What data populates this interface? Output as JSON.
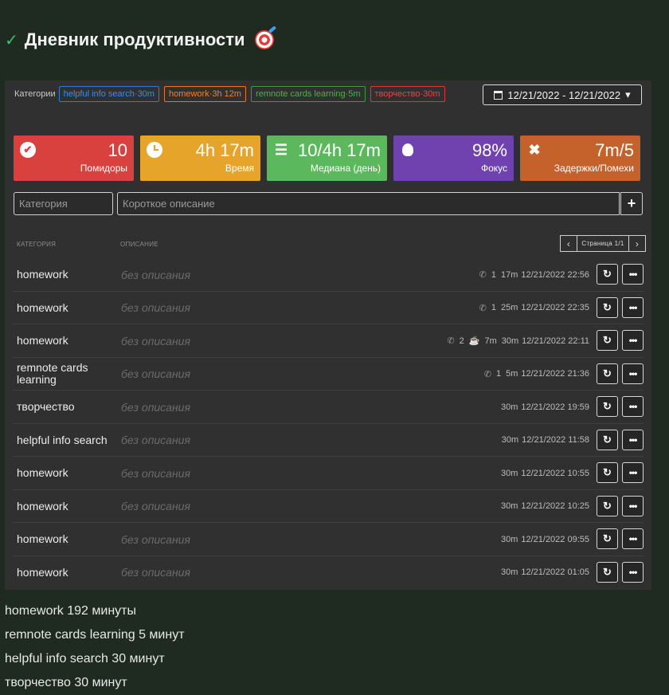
{
  "header": {
    "title": "Дневник продуктивности",
    "check": "✓"
  },
  "categories": {
    "label": "Категории",
    "tags": [
      {
        "text": "helpful info search·30m",
        "color": "blue"
      },
      {
        "text": "homework·3h 12m",
        "color": "orange"
      },
      {
        "text": "remnote cards learning·5m",
        "color": "green"
      },
      {
        "text": "творчество·30m",
        "color": "red"
      }
    ]
  },
  "date_range": "12/21/2022 - 12/21/2022",
  "stats": [
    {
      "value": "10",
      "caption": "Помидоры",
      "icon": "check-circle-icon",
      "color": "#d9413e"
    },
    {
      "value": "4h 17m",
      "caption": "Время",
      "icon": "clock-icon",
      "color": "#e6a52a"
    },
    {
      "value": "10/4h 17m",
      "caption": "Медиана (день)",
      "icon": "list-icon",
      "color": "#5cb85c"
    },
    {
      "value": "98%",
      "caption": "Фокус",
      "icon": "lightbulb-icon",
      "color": "#6f42b0"
    },
    {
      "value": "7m/5",
      "caption": "Задержки/Помехи",
      "icon": "close-icon",
      "color": "#c5612a"
    }
  ],
  "form": {
    "category_placeholder": "Категория",
    "description_placeholder": "Короткое описание",
    "add": "+"
  },
  "table": {
    "col_category": "КАТЕГОРИЯ",
    "col_description": "ОПИСАНИЕ",
    "page_label": "Страница 1/1",
    "empty_description": "без описания",
    "rows": [
      {
        "category": "homework",
        "calls": "1",
        "break": "",
        "duration": "17m",
        "datetime": "12/21/2022 22:56"
      },
      {
        "category": "homework",
        "calls": "1",
        "break": "",
        "duration": "25m",
        "datetime": "12/21/2022 22:35"
      },
      {
        "category": "homework",
        "calls": "2",
        "break": "7m",
        "duration": "30m",
        "datetime": "12/21/2022 22:11"
      },
      {
        "category": "remnote cards learning",
        "calls": "1",
        "break": "",
        "duration": "5m",
        "datetime": "12/21/2022 21:36"
      },
      {
        "category": "творчество",
        "calls": "",
        "break": "",
        "duration": "30m",
        "datetime": "12/21/2022 19:59"
      },
      {
        "category": "helpful info search",
        "calls": "",
        "break": "",
        "duration": "30m",
        "datetime": "12/21/2022 11:58"
      },
      {
        "category": "homework",
        "calls": "",
        "break": "",
        "duration": "30m",
        "datetime": "12/21/2022 10:55"
      },
      {
        "category": "homework",
        "calls": "",
        "break": "",
        "duration": "30m",
        "datetime": "12/21/2022 10:25"
      },
      {
        "category": "homework",
        "calls": "",
        "break": "",
        "duration": "30m",
        "datetime": "12/21/2022 09:55"
      },
      {
        "category": "homework",
        "calls": "",
        "break": "",
        "duration": "30m",
        "datetime": "12/21/2022 01:05"
      }
    ]
  },
  "summary": [
    "homework 192 минуты",
    "remnote cards learning 5 минут",
    "helpful info search 30 минут",
    "творчество 30 минут"
  ]
}
